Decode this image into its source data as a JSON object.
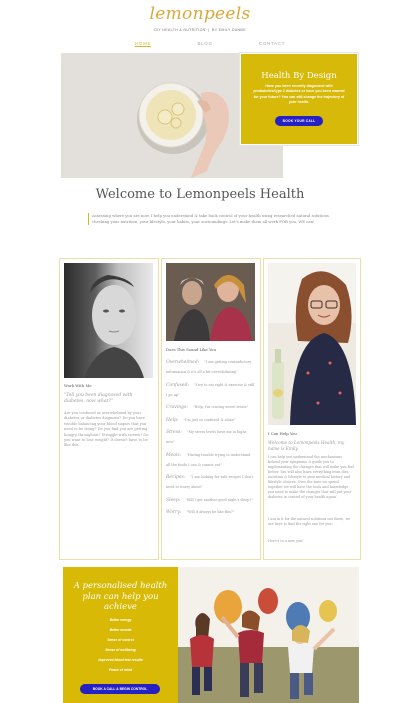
{
  "header": {
    "logo_text": "lemonpeels",
    "tagline_left": "DIY HEALTH & NUTRITION",
    "tagline_right": "BY EMILY DANBE",
    "nav": [
      "HOME",
      "BLOG",
      "CONTACT"
    ]
  },
  "hero": {
    "card_title": "Health By Design",
    "card_text": "Have you been recently diagnosed with prediabetes/type 2 diabetes or have you been warned for your future? You can still change the trajectory of your health.",
    "button_label": "BOOK YOUR CALL"
  },
  "welcome": {
    "title": "Welcome to Lemonpeels Health",
    "intro": "Assessing where you are now. I help you understand & take back control of your health using researched natural solutions checking your nutrition, your lifestyle, your habits, your surroundings. Let's make them all work FOR you, WE can!"
  },
  "col1": {
    "heading": "Work With Me",
    "quote": "\"Tell you been diagnosed with diabetes, now what?\"",
    "text": "Are you confused or overwhelmed by your diabetes or diabetes diagnosis? Do you have trouble balancing your blood sugars that you need to be doing? Do you find you are getting hungry throughout? Struggle with sweets? Do you want to lose weight? It doesn't have to be like this."
  },
  "col2": {
    "heading": "Does This Sound Like You",
    "items": [
      {
        "title": "Overwhelmed:",
        "text": "\"I am getting contradictory information & it's all a bit overwhelming\""
      },
      {
        "title": "Confused:",
        "text": "\"I try to eat right & exercise & still I go up\""
      },
      {
        "title": "Cravings:",
        "text": "\"Help, I'm craving sweet treats\""
      },
      {
        "title": "Help:",
        "text": "\"I'm just so confused & alone\""
      },
      {
        "title": "Stress:",
        "text": "\"My stress levels have me in highs now\""
      },
      {
        "title": "Meals:",
        "text": "\"Having trouble trying to understand all the foods I can & cannot eat\""
      },
      {
        "title": "Recipes:",
        "text": "\"I am looking for safe recipes I don't need to worry about\""
      },
      {
        "title": "Sleep:",
        "text": "\"Will I get another good night's sleep?\""
      },
      {
        "title": "Worry:",
        "text": "\"Will it always be like this?\""
      }
    ]
  },
  "col3": {
    "heading": "I Can Help You",
    "p1": "Welcome to Lemonpeels Health, my name is Emily.",
    "p2": "I can help you understand the mechanisms behind your symptoms & guide you to implementing the changes that will make you feel better. You will also learn everything from diet, nutrition & lifestyle to your medical history and lifestyle choices. Over the time we spend together we will have the tools and knowledge you need to make the changes that will put your diabetes in control of your health again.",
    "p3": "I am in it for the natural solutions out there, we are here to find the right one for you!",
    "p4": "Here's to a new you!"
  },
  "bottom": {
    "title": "A personalised health plan can help you achieve",
    "benefits": [
      "Better energy",
      "Better moods",
      "Sense of control",
      "Sense of wellbeing",
      "Improved blood test results",
      "Peace of mind"
    ],
    "button_label": "BOOK A CALL & BEGIN CONTROL"
  },
  "colors": {
    "accent_yellow": "#d7b90a",
    "button_blue": "#2621c4",
    "logo_gold": "#d9a93a"
  }
}
